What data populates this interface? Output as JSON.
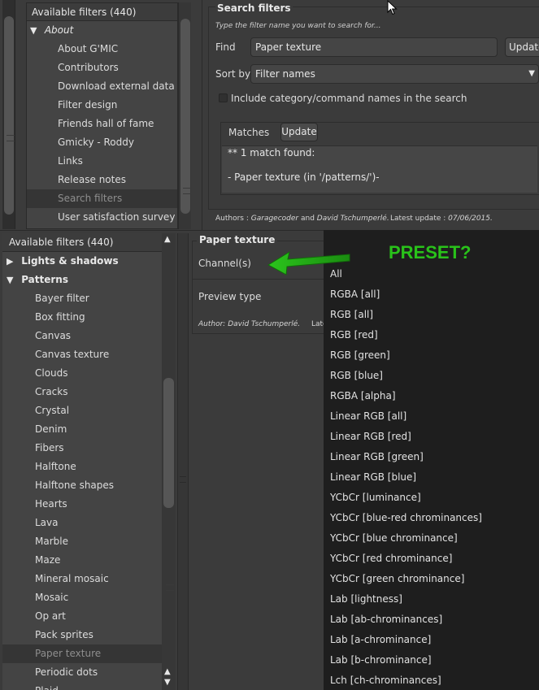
{
  "top_tree": {
    "header": "Available filters (440)",
    "category": "About",
    "category_arrow": "▼",
    "items": [
      {
        "label": "About G'MIC"
      },
      {
        "label": "Contributors"
      },
      {
        "label": "Download external data"
      },
      {
        "label": "Filter design"
      },
      {
        "label": "Friends hall of fame"
      },
      {
        "label": "Gmicky - Roddy"
      },
      {
        "label": "Links"
      },
      {
        "label": "Release notes"
      },
      {
        "label": "Search filters"
      },
      {
        "label": "User satisfaction survey"
      }
    ]
  },
  "search_panel": {
    "title": "Search filters",
    "hint": "Type the filter name you want to search for...",
    "find_label": "Find",
    "find_value": "Paper texture",
    "update_label": "Update",
    "sort_label": "Sort by",
    "sort_value": "Filter names",
    "include_label": "Include category/command names in the search",
    "matches_label": "Matches",
    "matches_update_label": "Update",
    "matches_lines": [
      "** 1 match found:",
      "",
      "- Paper texture (in '/patterns/')-"
    ],
    "authors_prefix": "Authors : ",
    "author1": "Garagecoder",
    "authors_and": " and ",
    "author2": "David Tschumperlé.",
    "latest_prefix": "Latest update : ",
    "latest_date": "07/06/2015."
  },
  "bottom_tree": {
    "header": "Available filters (440)",
    "categories": [
      {
        "label": "Lights & shadows",
        "arrow": "▶"
      },
      {
        "label": "Patterns",
        "arrow": "▼"
      }
    ],
    "items": [
      {
        "label": "Bayer filter"
      },
      {
        "label": "Box fitting"
      },
      {
        "label": "Canvas"
      },
      {
        "label": "Canvas texture"
      },
      {
        "label": "Clouds"
      },
      {
        "label": "Cracks"
      },
      {
        "label": "Crystal"
      },
      {
        "label": "Denim"
      },
      {
        "label": "Fibers"
      },
      {
        "label": "Halftone"
      },
      {
        "label": "Halftone shapes"
      },
      {
        "label": "Hearts"
      },
      {
        "label": "Lava"
      },
      {
        "label": "Marble"
      },
      {
        "label": "Maze"
      },
      {
        "label": "Mineral mosaic"
      },
      {
        "label": "Mosaic"
      },
      {
        "label": "Op art"
      },
      {
        "label": "Pack sprites"
      },
      {
        "label": "Paper texture"
      },
      {
        "label": "Periodic dots"
      },
      {
        "label": "Plaid"
      }
    ]
  },
  "params_panel": {
    "title": "Paper texture",
    "channels_label": "Channel(s)",
    "preview_label": "Preview type",
    "author_text": "Author: David Tschumperlé.",
    "latest_text": "Late"
  },
  "channel_dropdown": {
    "options": [
      "All",
      "RGBA [all]",
      "RGB [all]",
      "RGB [red]",
      "RGB [green]",
      "RGB [blue]",
      "RGBA [alpha]",
      "Linear RGB [all]",
      "Linear RGB [red]",
      "Linear RGB [green]",
      "Linear RGB [blue]",
      "YCbCr [luminance]",
      "YCbCr [blue-red chrominances]",
      "YCbCr [blue chrominance]",
      "YCbCr [red chrominance]",
      "YCbCr [green chrominance]",
      "Lab [lightness]",
      "Lab [ab-chrominances]",
      "Lab [a-chrominance]",
      "Lab [b-chrominance]",
      "Lch [ch-chrominances]"
    ]
  },
  "annotation": {
    "text": "PRESET?",
    "color": "#29c21a"
  },
  "icons": {
    "scroll_up": "▲",
    "scroll_down": "▼",
    "combo_down": "▼"
  }
}
